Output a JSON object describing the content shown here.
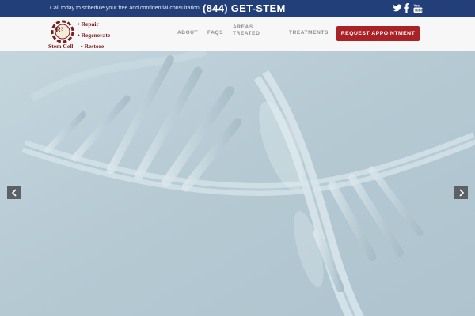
{
  "topbar": {
    "tagline": "Call today to schedule your free and confidential consultation.",
    "phone": "(844) GET-STEM",
    "social": [
      {
        "icon": "twitter-icon",
        "color": "#ffffff"
      },
      {
        "icon": "facebook-icon",
        "color": "#ffffff"
      },
      {
        "icon": "youtube-icon",
        "color": "#ffffff"
      }
    ]
  },
  "logo": {
    "mark": "R³",
    "line1": "• Repair",
    "line2": "• Regenerate",
    "brand_left": "Stem Cell",
    "line3": "• Restore"
  },
  "nav": {
    "items": [
      {
        "label": "ABOUT"
      },
      {
        "label": "FAQS"
      },
      {
        "label_line1": "AREAS",
        "label_line2": "TREATED"
      },
      {
        "label": "TREATMENTS"
      }
    ],
    "cta": "REQUEST APPOINTMENT"
  },
  "colors": {
    "topbar": "#233f7a",
    "cta": "#a92225",
    "logo": "#7a1f1f",
    "hero": "#b7ccd6"
  },
  "hero": {
    "image": "dna-helix-image",
    "prev_icon": "chevron-left-icon",
    "next_icon": "chevron-right-icon"
  }
}
